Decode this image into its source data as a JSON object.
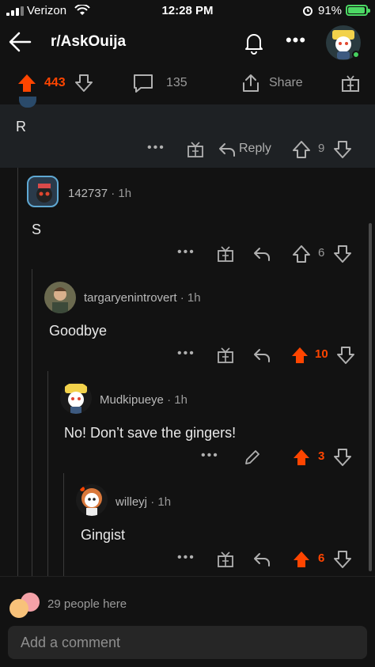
{
  "status_bar": {
    "carrier": "Verizon",
    "time": "12:28 PM",
    "battery_pct": "91%"
  },
  "header": {
    "subreddit": "r/AskOuija"
  },
  "post_actions": {
    "upvotes": "443",
    "comments": "135",
    "share_label": "Share"
  },
  "comments": [
    {
      "body": "R",
      "votes": "9",
      "reply_label": "Reply"
    },
    {
      "username": "142737",
      "age": "1h",
      "body": "S",
      "votes": "6"
    },
    {
      "username": "targaryenintrovert",
      "age": "1h",
      "body": "Goodbye",
      "votes": "10"
    },
    {
      "username": "Mudkipueye",
      "age": "1h",
      "body": "No! Don’t save the gingers!",
      "votes": "3"
    },
    {
      "username": "willeyj",
      "age": "1h",
      "body": "Gingist",
      "votes": "6"
    }
  ],
  "footer": {
    "presence": "29 people here",
    "comment_placeholder": "Add a comment"
  },
  "colors": {
    "accent": "#ff4500",
    "background": "#121212",
    "muted": "#9a9a9a",
    "online": "#46d160"
  }
}
